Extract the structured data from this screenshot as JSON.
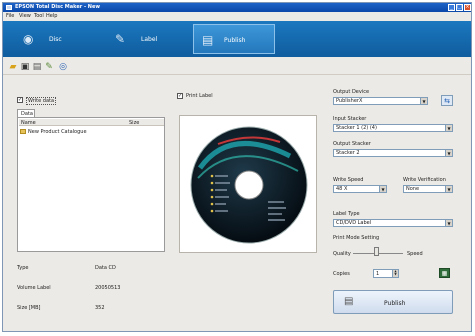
{
  "window": {
    "title": "EPSON Total Disc Maker - New",
    "min_label": "_",
    "max_label": "□",
    "close_label": "×"
  },
  "menu": [
    "File",
    "View",
    "Tool",
    "Help"
  ],
  "modes": [
    {
      "label": "Disc"
    },
    {
      "label": "Label"
    },
    {
      "label": "Publish"
    }
  ],
  "left": {
    "write_label": "Write data",
    "tab": "Data",
    "col_name": "Name",
    "col_size": "Size",
    "item": "New Product Catalogue",
    "type_label": "Type",
    "type_value": "Data CD",
    "volume_label": "Volume Label",
    "volume_value": "20050513",
    "size_label": "Size [MB]",
    "size_value": "352"
  },
  "center": {
    "print_label": "Print Label"
  },
  "right": {
    "output_device_label": "Output Device",
    "output_device_value": "PublisherX",
    "input_stacker_label": "Input Stacker",
    "input_stacker_value": "Stacker 1 (2) (4)",
    "output_stacker_label": "Output Stacker",
    "output_stacker_value": "Stacker 2",
    "write_speed_label": "Write Speed",
    "write_speed_value": "48 X",
    "write_verification_label": "Write Verification",
    "write_verification_value": "None",
    "label_type_label": "Label Type",
    "label_type_value": "CD/DVD Label",
    "print_mode_label": "Print Mode Setting",
    "quality_label": "Quality",
    "speed_label": "Speed",
    "copies_label": "Copies",
    "copies_value": "1",
    "publish_button": "Publish"
  },
  "colors": {
    "mode_bar": "#1c78bf",
    "disc_dark": "#0b1b28",
    "disc_arc": "#1fb0b8",
    "disc_text": "#d83a3a"
  }
}
